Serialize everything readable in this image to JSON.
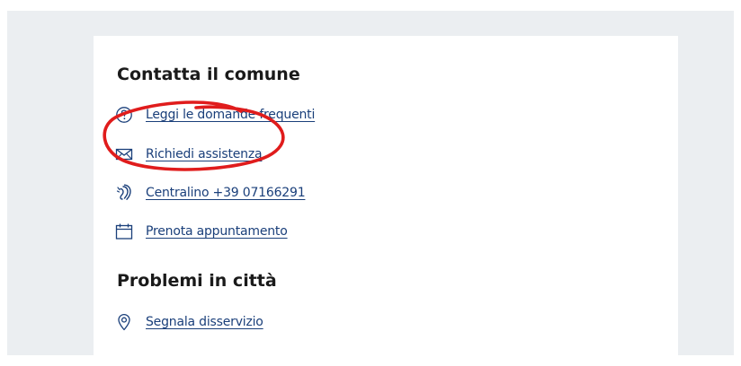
{
  "sections": [
    {
      "title": "Contatta il comune",
      "links": [
        {
          "label": "Leggi le domande frequenti",
          "icon": "help-circle-icon"
        },
        {
          "label": "Richiedi assistenza",
          "icon": "envelope-icon"
        },
        {
          "label": "Centralino +39 07166291",
          "icon": "hearing-icon"
        },
        {
          "label": "Prenota appuntamento",
          "icon": "calendar-icon"
        }
      ]
    },
    {
      "title": "Problemi in città",
      "links": [
        {
          "label": "Segnala disservizio",
          "icon": "map-marker-icon"
        }
      ]
    }
  ],
  "colors": {
    "link": "#1a3f7a",
    "icon": "#1a3f7a",
    "heading": "#1a1a1a",
    "background": "#ebeef1",
    "card": "#ffffff",
    "annotation": "#e01c1c"
  }
}
